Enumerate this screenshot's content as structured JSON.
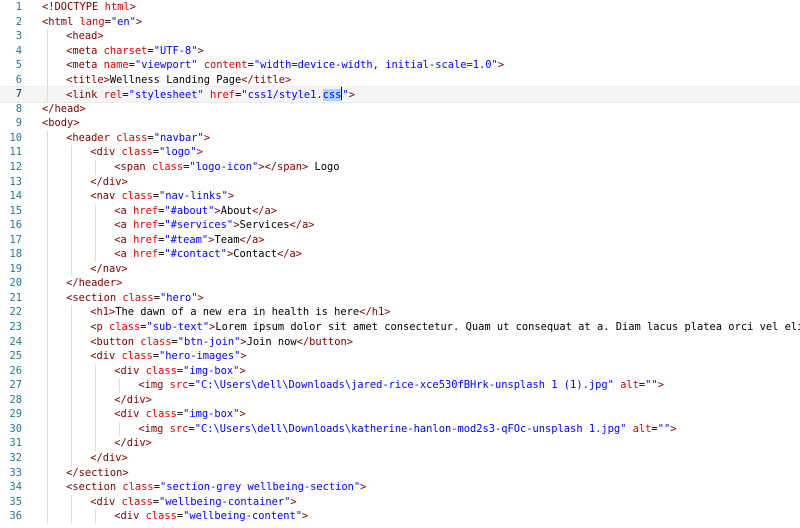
{
  "editor": {
    "current_line": 7,
    "lines": [
      {
        "n": "1",
        "indent": 0,
        "tokens": [
          {
            "c": "p",
            "v": "<!DOCTYPE "
          },
          {
            "c": "a",
            "v": "html"
          },
          {
            "c": "p",
            "v": ">"
          }
        ]
      },
      {
        "n": "2",
        "indent": 0,
        "tokens": [
          {
            "c": "t",
            "v": "<html "
          },
          {
            "c": "a",
            "v": "lang"
          },
          {
            "c": "x",
            "v": "="
          },
          {
            "c": "s",
            "v": "\"en\""
          },
          {
            "c": "t",
            "v": ">"
          }
        ]
      },
      {
        "n": "3",
        "indent": 1,
        "tokens": [
          {
            "c": "t",
            "v": "<head>"
          }
        ]
      },
      {
        "n": "4",
        "indent": 1,
        "tokens": [
          {
            "c": "t",
            "v": "<meta "
          },
          {
            "c": "a",
            "v": "charset"
          },
          {
            "c": "x",
            "v": "="
          },
          {
            "c": "s",
            "v": "\"UTF-8\""
          },
          {
            "c": "t",
            "v": ">"
          }
        ]
      },
      {
        "n": "5",
        "indent": 1,
        "tokens": [
          {
            "c": "t",
            "v": "<meta "
          },
          {
            "c": "a",
            "v": "name"
          },
          {
            "c": "x",
            "v": "="
          },
          {
            "c": "s",
            "v": "\"viewport\""
          },
          {
            "c": "x",
            "v": " "
          },
          {
            "c": "a",
            "v": "content"
          },
          {
            "c": "x",
            "v": "="
          },
          {
            "c": "s",
            "v": "\"width=device-width, initial-scale=1.0\""
          },
          {
            "c": "t",
            "v": ">"
          }
        ]
      },
      {
        "n": "6",
        "indent": 1,
        "tokens": [
          {
            "c": "t",
            "v": "<title>"
          },
          {
            "c": "x",
            "v": "Wellness Landing Page"
          },
          {
            "c": "t",
            "v": "</title>"
          }
        ]
      },
      {
        "n": "7",
        "indent": 1,
        "tokens": [
          {
            "c": "t",
            "v": "<link "
          },
          {
            "c": "a",
            "v": "rel"
          },
          {
            "c": "x",
            "v": "="
          },
          {
            "c": "s",
            "v": "\"stylesheet\""
          },
          {
            "c": "x",
            "v": " "
          },
          {
            "c": "a",
            "v": "href"
          },
          {
            "c": "x",
            "v": "="
          },
          {
            "c": "s",
            "v": "\"css1/style1."
          },
          {
            "c": "s sel",
            "v": "css"
          },
          {
            "c": "cursor",
            "v": ""
          },
          {
            "c": "s",
            "v": "\""
          },
          {
            "c": "t",
            "v": ">"
          }
        ]
      },
      {
        "n": "8",
        "indent": 0,
        "tokens": [
          {
            "c": "t",
            "v": "</head>"
          }
        ]
      },
      {
        "n": "9",
        "indent": 0,
        "tokens": [
          {
            "c": "t",
            "v": "<body>"
          }
        ]
      },
      {
        "n": "10",
        "indent": 1,
        "tokens": [
          {
            "c": "t",
            "v": "<header "
          },
          {
            "c": "a",
            "v": "class"
          },
          {
            "c": "x",
            "v": "="
          },
          {
            "c": "s",
            "v": "\"navbar\""
          },
          {
            "c": "t",
            "v": ">"
          }
        ]
      },
      {
        "n": "11",
        "indent": 2,
        "tokens": [
          {
            "c": "t",
            "v": "<div "
          },
          {
            "c": "a",
            "v": "class"
          },
          {
            "c": "x",
            "v": "="
          },
          {
            "c": "s",
            "v": "\"logo\""
          },
          {
            "c": "t",
            "v": ">"
          }
        ]
      },
      {
        "n": "12",
        "indent": 3,
        "tokens": [
          {
            "c": "t",
            "v": "<span "
          },
          {
            "c": "a",
            "v": "class"
          },
          {
            "c": "x",
            "v": "="
          },
          {
            "c": "s",
            "v": "\"logo-icon\""
          },
          {
            "c": "t",
            "v": "></span>"
          },
          {
            "c": "x",
            "v": " Logo"
          }
        ]
      },
      {
        "n": "13",
        "indent": 2,
        "tokens": [
          {
            "c": "t",
            "v": "</div>"
          }
        ]
      },
      {
        "n": "14",
        "indent": 2,
        "tokens": [
          {
            "c": "t",
            "v": "<nav "
          },
          {
            "c": "a",
            "v": "class"
          },
          {
            "c": "x",
            "v": "="
          },
          {
            "c": "s",
            "v": "\"nav-links\""
          },
          {
            "c": "t",
            "v": ">"
          }
        ]
      },
      {
        "n": "15",
        "indent": 3,
        "tokens": [
          {
            "c": "t",
            "v": "<a "
          },
          {
            "c": "a",
            "v": "href"
          },
          {
            "c": "x",
            "v": "="
          },
          {
            "c": "s",
            "v": "\"#about\""
          },
          {
            "c": "t",
            "v": ">"
          },
          {
            "c": "x",
            "v": "About"
          },
          {
            "c": "t",
            "v": "</a>"
          }
        ]
      },
      {
        "n": "16",
        "indent": 3,
        "tokens": [
          {
            "c": "t",
            "v": "<a "
          },
          {
            "c": "a",
            "v": "href"
          },
          {
            "c": "x",
            "v": "="
          },
          {
            "c": "s",
            "v": "\"#services\""
          },
          {
            "c": "t",
            "v": ">"
          },
          {
            "c": "x",
            "v": "Services"
          },
          {
            "c": "t",
            "v": "</a>"
          }
        ]
      },
      {
        "n": "17",
        "indent": 3,
        "tokens": [
          {
            "c": "t",
            "v": "<a "
          },
          {
            "c": "a",
            "v": "href"
          },
          {
            "c": "x",
            "v": "="
          },
          {
            "c": "s",
            "v": "\"#team\""
          },
          {
            "c": "t",
            "v": ">"
          },
          {
            "c": "x",
            "v": "Team"
          },
          {
            "c": "t",
            "v": "</a>"
          }
        ]
      },
      {
        "n": "18",
        "indent": 3,
        "tokens": [
          {
            "c": "t",
            "v": "<a "
          },
          {
            "c": "a",
            "v": "href"
          },
          {
            "c": "x",
            "v": "="
          },
          {
            "c": "s",
            "v": "\"#contact\""
          },
          {
            "c": "t",
            "v": ">"
          },
          {
            "c": "x",
            "v": "Contact"
          },
          {
            "c": "t",
            "v": "</a>"
          }
        ]
      },
      {
        "n": "19",
        "indent": 2,
        "tokens": [
          {
            "c": "t",
            "v": "</nav>"
          }
        ]
      },
      {
        "n": "20",
        "indent": 1,
        "tokens": [
          {
            "c": "t",
            "v": "</header>"
          }
        ]
      },
      {
        "n": "21",
        "indent": 1,
        "tokens": [
          {
            "c": "t",
            "v": "<section "
          },
          {
            "c": "a",
            "v": "class"
          },
          {
            "c": "x",
            "v": "="
          },
          {
            "c": "s",
            "v": "\"hero\""
          },
          {
            "c": "t",
            "v": ">"
          }
        ]
      },
      {
        "n": "22",
        "indent": 2,
        "tokens": [
          {
            "c": "t",
            "v": "<h1>"
          },
          {
            "c": "x",
            "v": "The dawn of a new era in health is here"
          },
          {
            "c": "t",
            "v": "</h1>"
          }
        ]
      },
      {
        "n": "23",
        "indent": 2,
        "tokens": [
          {
            "c": "t",
            "v": "<p "
          },
          {
            "c": "a",
            "v": "class"
          },
          {
            "c": "x",
            "v": "="
          },
          {
            "c": "s",
            "v": "\"sub-text\""
          },
          {
            "c": "t",
            "v": ">"
          },
          {
            "c": "x",
            "v": "Lorem ipsum dolor sit amet consectetur. Quam ut consequat at a. Diam lacus platea orci vel elit bland"
          }
        ]
      },
      {
        "n": "24",
        "indent": 2,
        "tokens": [
          {
            "c": "t",
            "v": "<button "
          },
          {
            "c": "a",
            "v": "class"
          },
          {
            "c": "x",
            "v": "="
          },
          {
            "c": "s",
            "v": "\"btn-join\""
          },
          {
            "c": "t",
            "v": ">"
          },
          {
            "c": "x",
            "v": "Join now"
          },
          {
            "c": "t",
            "v": "</button>"
          }
        ]
      },
      {
        "n": "25",
        "indent": 2,
        "tokens": [
          {
            "c": "t",
            "v": "<div "
          },
          {
            "c": "a",
            "v": "class"
          },
          {
            "c": "x",
            "v": "="
          },
          {
            "c": "s",
            "v": "\"hero-images\""
          },
          {
            "c": "t",
            "v": ">"
          }
        ]
      },
      {
        "n": "26",
        "indent": 3,
        "tokens": [
          {
            "c": "t",
            "v": "<div "
          },
          {
            "c": "a",
            "v": "class"
          },
          {
            "c": "x",
            "v": "="
          },
          {
            "c": "s",
            "v": "\"img-box\""
          },
          {
            "c": "t",
            "v": ">"
          }
        ]
      },
      {
        "n": "27",
        "indent": 4,
        "tokens": [
          {
            "c": "t",
            "v": "<img "
          },
          {
            "c": "a",
            "v": "src"
          },
          {
            "c": "x",
            "v": "="
          },
          {
            "c": "s",
            "v": "\"C:\\Users\\dell\\Downloads\\jared-rice-xce530fBHrk-unsplash 1 (1).jpg\""
          },
          {
            "c": "x",
            "v": " "
          },
          {
            "c": "a",
            "v": "alt"
          },
          {
            "c": "x",
            "v": "="
          },
          {
            "c": "s",
            "v": "\"\""
          },
          {
            "c": "t",
            "v": ">"
          }
        ]
      },
      {
        "n": "28",
        "indent": 3,
        "tokens": [
          {
            "c": "t",
            "v": "</div>"
          }
        ]
      },
      {
        "n": "29",
        "indent": 3,
        "tokens": [
          {
            "c": "t",
            "v": "<div "
          },
          {
            "c": "a",
            "v": "class"
          },
          {
            "c": "x",
            "v": "="
          },
          {
            "c": "s",
            "v": "\"img-box\""
          },
          {
            "c": "t",
            "v": ">"
          }
        ]
      },
      {
        "n": "30",
        "indent": 4,
        "tokens": [
          {
            "c": "t",
            "v": "<img "
          },
          {
            "c": "a",
            "v": "src"
          },
          {
            "c": "x",
            "v": "="
          },
          {
            "c": "s",
            "v": "\"C:\\Users\\dell\\Downloads\\katherine-hanlon-mod2s3-qFOc-unsplash 1.jpg\""
          },
          {
            "c": "x",
            "v": " "
          },
          {
            "c": "a",
            "v": "alt"
          },
          {
            "c": "x",
            "v": "="
          },
          {
            "c": "s",
            "v": "\"\""
          },
          {
            "c": "t",
            "v": ">"
          }
        ]
      },
      {
        "n": "31",
        "indent": 3,
        "tokens": [
          {
            "c": "t",
            "v": "</div>"
          }
        ]
      },
      {
        "n": "32",
        "indent": 2,
        "tokens": [
          {
            "c": "t",
            "v": "</div>"
          }
        ]
      },
      {
        "n": "33",
        "indent": 1,
        "tokens": [
          {
            "c": "t",
            "v": "</section>"
          }
        ]
      },
      {
        "n": "34",
        "indent": 1,
        "tokens": [
          {
            "c": "t",
            "v": "<section "
          },
          {
            "c": "a",
            "v": "class"
          },
          {
            "c": "x",
            "v": "="
          },
          {
            "c": "s",
            "v": "\"section-grey wellbeing-section\""
          },
          {
            "c": "t",
            "v": ">"
          }
        ]
      },
      {
        "n": "35",
        "indent": 2,
        "tokens": [
          {
            "c": "t",
            "v": "<div "
          },
          {
            "c": "a",
            "v": "class"
          },
          {
            "c": "x",
            "v": "="
          },
          {
            "c": "s",
            "v": "\"wellbeing-container\""
          },
          {
            "c": "t",
            "v": ">"
          }
        ]
      },
      {
        "n": "36",
        "indent": 3,
        "tokens": [
          {
            "c": "t",
            "v": "<div "
          },
          {
            "c": "a",
            "v": "class"
          },
          {
            "c": "x",
            "v": "="
          },
          {
            "c": "s",
            "v": "\"wellbeing-content\""
          },
          {
            "c": "t",
            "v": ">"
          }
        ]
      }
    ]
  }
}
